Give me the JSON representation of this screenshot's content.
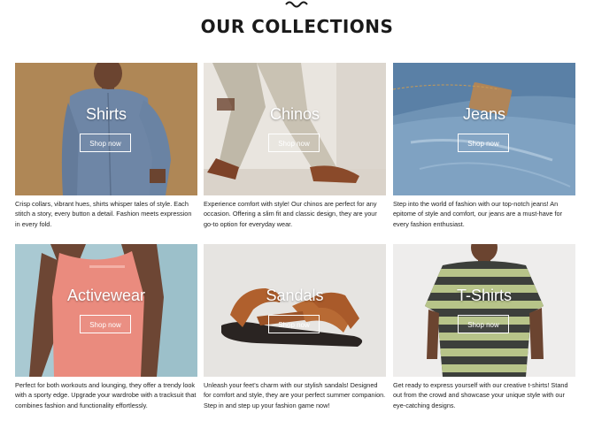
{
  "header": {
    "title": "OUR COLLECTIONS",
    "decoration_icon": "wave-icon"
  },
  "collections": [
    {
      "name": "Shirts",
      "button": "Shop now",
      "description": "Crisp collars, vibrant hues, shirts whisper tales of style. Each stitch a story, every button a detail. Fashion meets expression in every fold."
    },
    {
      "name": "Chinos",
      "button": "Shop now",
      "description": "Experience comfort with style! Our chinos are perfect for any occasion. Offering a slim fit and classic design, they are your go-to option for everyday wear."
    },
    {
      "name": "Jeans",
      "button": "Shop now",
      "description": "Step into the world of fashion with our top-notch jeans! An epitome of style and comfort, our jeans are a must-have for every fashion enthusiast."
    },
    {
      "name": "Activewear",
      "button": "Shop now",
      "description": "Perfect for both workouts and lounging, they offer a trendy look with a sporty edge. Upgrade your wardrobe with a tracksuit that combines fashion and functionality effortlessly."
    },
    {
      "name": "Sandals",
      "button": "Shop now",
      "description": "Unleash your feet's charm with our stylish sandals! Designed for comfort and style, they are your perfect summer companion. Step in and step up your fashion game now!"
    },
    {
      "name": "T-Shirts",
      "button": "Shop now",
      "description": "Get ready to express yourself with our creative t-shirts! Stand out from the crowd and showcase your unique style with our eye-catching designs."
    }
  ]
}
